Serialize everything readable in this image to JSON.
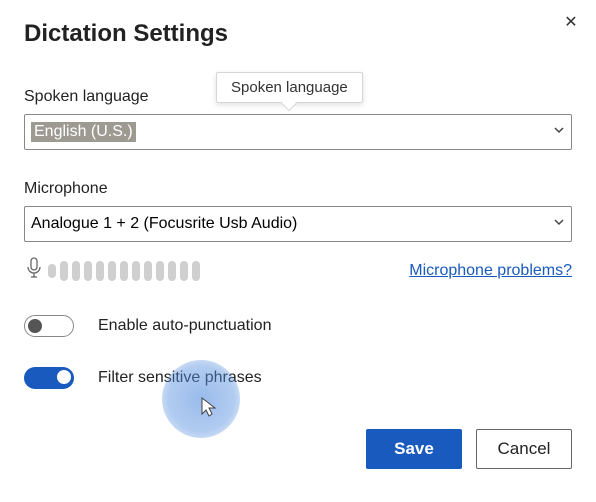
{
  "dialog": {
    "title": "Dictation Settings",
    "tooltip": "Spoken language"
  },
  "language": {
    "label": "Spoken language",
    "selected": "English (U.S.)"
  },
  "microphone": {
    "label": "Microphone",
    "selected": "Analogue 1 + 2 (Focusrite Usb Audio)",
    "problems_link": "Microphone problems?"
  },
  "toggles": {
    "auto_punctuation": {
      "label": "Enable auto-punctuation",
      "on": false
    },
    "filter_sensitive": {
      "label": "Filter sensitive phrases",
      "on": true
    }
  },
  "buttons": {
    "save": "Save",
    "cancel": "Cancel"
  }
}
